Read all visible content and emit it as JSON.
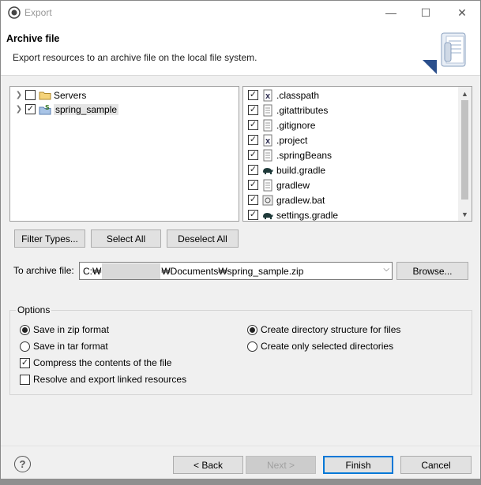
{
  "window": {
    "title": "Export",
    "minimize_glyph": "—",
    "maximize_glyph": "☐",
    "close_glyph": "✕"
  },
  "banner": {
    "title": "Archive file",
    "description": "Export resources to an archive file on the local file system.",
    "icon": "archive-export-wizard-icon"
  },
  "projects_tree": {
    "items": [
      {
        "label": "Servers",
        "checked": false,
        "icon": "folder-icon"
      },
      {
        "label": "spring_sample",
        "checked": true,
        "icon": "spring-project-icon",
        "selected": true
      }
    ]
  },
  "files_list": {
    "items": [
      {
        "label": ".classpath",
        "checked": true,
        "icon": "xml-file-icon"
      },
      {
        "label": ".gitattributes",
        "checked": true,
        "icon": "text-file-icon"
      },
      {
        "label": ".gitignore",
        "checked": true,
        "icon": "text-file-icon"
      },
      {
        "label": ".project",
        "checked": true,
        "icon": "xml-file-icon"
      },
      {
        "label": ".springBeans",
        "checked": true,
        "icon": "text-file-icon"
      },
      {
        "label": "build.gradle",
        "checked": true,
        "icon": "gradle-elephant-icon"
      },
      {
        "label": "gradlew",
        "checked": true,
        "icon": "text-file-icon"
      },
      {
        "label": "gradlew.bat",
        "checked": true,
        "icon": "batch-file-icon"
      },
      {
        "label": "settings.gradle",
        "checked": true,
        "icon": "gradle-elephant-icon"
      }
    ]
  },
  "selection_buttons": {
    "filter_types": "Filter Types...",
    "select_all": "Select All",
    "deselect_all": "Deselect All"
  },
  "destination": {
    "label": "To archive file:",
    "value_prefix": "C:₩",
    "value_suffix": "₩Documents₩spring_sample.zip",
    "browse": "Browse..."
  },
  "options": {
    "title": "Options",
    "save_zip": {
      "label": "Save in zip format",
      "selected": true
    },
    "save_tar": {
      "label": "Save in tar format",
      "selected": false
    },
    "compress": {
      "label": "Compress the contents of the file",
      "checked": true
    },
    "resolve_linked": {
      "label": "Resolve and export linked resources",
      "checked": false
    },
    "create_structure": {
      "label": "Create directory structure for files",
      "selected": true
    },
    "create_selected": {
      "label": "Create only selected directories",
      "selected": false
    }
  },
  "footer": {
    "help_glyph": "?",
    "back": "< Back",
    "next": "Next >",
    "finish": "Finish",
    "cancel": "Cancel"
  },
  "colors": {
    "accent": "#0078d7",
    "window_bg": "#f0f0f0"
  }
}
